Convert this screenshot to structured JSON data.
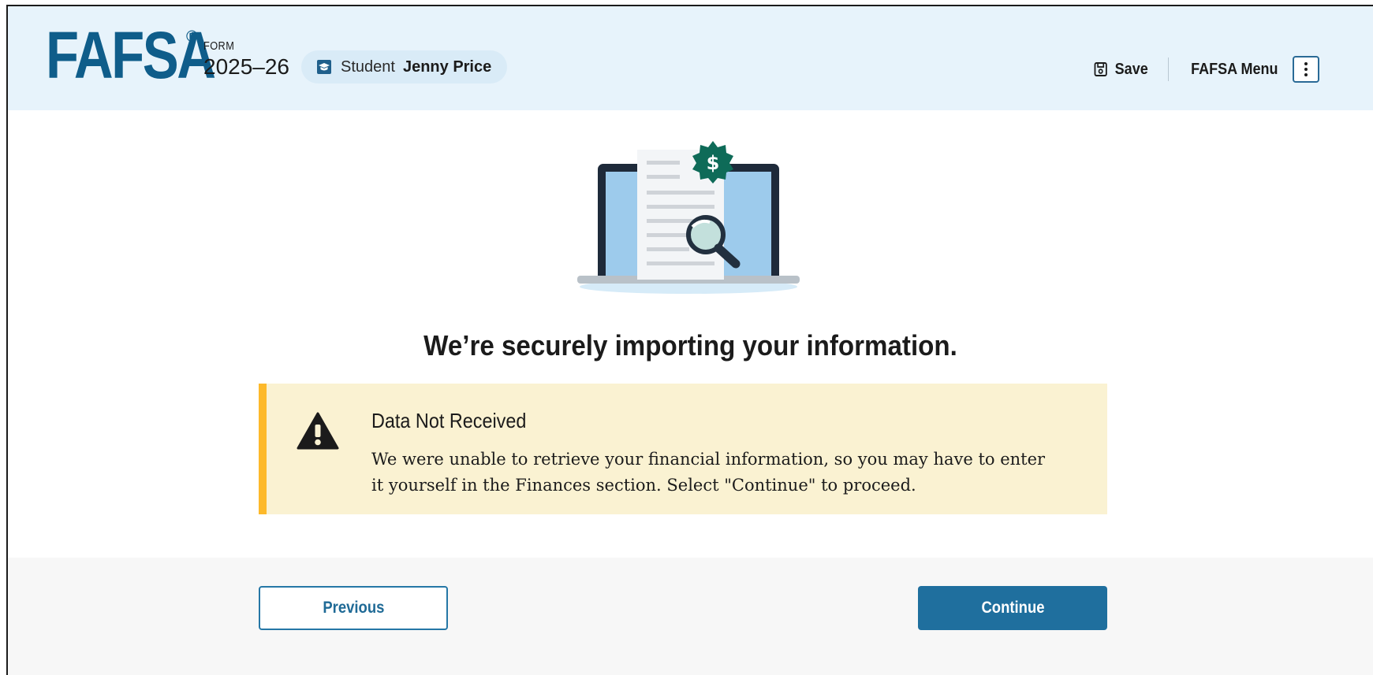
{
  "header": {
    "logo_text": "FAFSA",
    "logo_registered": "®",
    "form_label": "FORM",
    "form_year": "2025–26",
    "student": {
      "label": "Student",
      "name": "Jenny Price",
      "icon": "graduation-cap-icon"
    },
    "save_label": "Save",
    "menu_label": "FAFSA Menu"
  },
  "main": {
    "illustration": "laptop-document-search-dollar-illustration",
    "headline": "We’re securely importing your information."
  },
  "alert": {
    "type": "warning",
    "icon": "warning-triangle-icon",
    "title": "Data Not Received",
    "body_line1": "We were unable to retrieve your financial information, so you may have to enter",
    "body_line2": "it yourself in the Finances section. Select \"Continue\" to proceed."
  },
  "footer": {
    "previous_label": "Previous",
    "continue_label": "Continue"
  },
  "colors": {
    "brand_blue": "#0f5d8a",
    "header_bg": "#e7f3fb",
    "alert_bg": "#faf2d2",
    "alert_border": "#fdb92a",
    "primary_button": "#1f6f9e",
    "seal_green": "#0e6b58"
  }
}
